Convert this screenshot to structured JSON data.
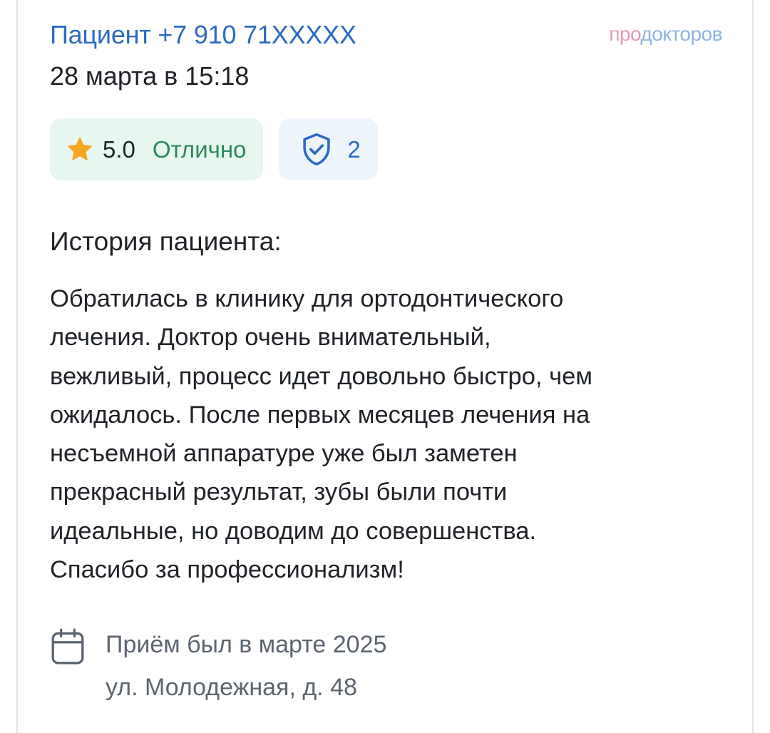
{
  "brand": {
    "part1": "про",
    "part2": "докторов"
  },
  "review": {
    "author": "Пациент +7 910 71XXXXX",
    "date": "28 марта в 15:18",
    "rating": {
      "score": "5.0",
      "grade": "Отлично"
    },
    "verified_count": "2",
    "section_title": "История пациента:",
    "text_lines": [
      "Обратилась в клинику для ортодонтического",
      "лечения. Доктор очень внимательный,",
      "вежливый, процесс идет довольно быстро, чем",
      "ожидалось. После первых месяцев лечения на",
      "несъемной аппаратуре уже был заметен",
      "прекрасный результат, зубы были почти",
      "идеальные, но доводим до совершенства.",
      "Спасибо за профессионализм!"
    ],
    "visit": {
      "date_text": "Приём был в марте 2025",
      "address": "ул. Молодежная, д. 48"
    }
  },
  "icons": {
    "star": "star-icon",
    "shield": "shield-check-icon",
    "calendar": "calendar-icon"
  },
  "colors": {
    "link_blue": "#2e6ac2",
    "rating_bg": "#e7f6ee",
    "rating_text": "#2e8a5b",
    "verified_bg": "#eef4fc",
    "star": "#f5a623",
    "muted": "#5d6570",
    "brand_pink": "#e39bb0",
    "brand_blue": "#8fb4de"
  }
}
